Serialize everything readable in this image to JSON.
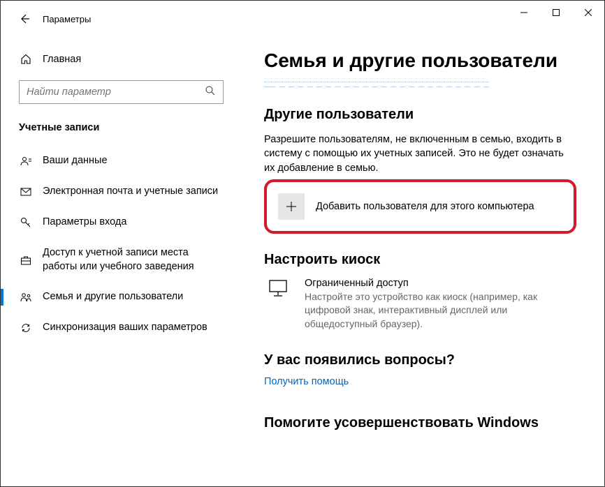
{
  "header": {
    "app_title": "Параметры"
  },
  "sidebar": {
    "home_label": "Главная",
    "search_placeholder": "Найти параметр",
    "section_label": "Учетные записи",
    "items": [
      {
        "label": "Ваши данные"
      },
      {
        "label": "Электронная почта и учетные записи"
      },
      {
        "label": "Параметры входа"
      },
      {
        "label": "Доступ к учетной записи места работы или учебного заведения"
      },
      {
        "label": "Семья и другие пользователи"
      },
      {
        "label": "Синхронизация ваших параметров"
      }
    ]
  },
  "content": {
    "page_title": "Семья и другие пользователи",
    "other_users_heading": "Другие пользователи",
    "other_users_desc": "Разрешите пользователям, не включенным в семью, входить в систему с помощью их учетных записей. Это не будет означать их добавление в семью.",
    "add_user_label": "Добавить пользователя для этого компьютера",
    "kiosk_heading": "Настроить киоск",
    "kiosk_title": "Ограниченный доступ",
    "kiosk_desc": "Настройте это устройство как киоск (например, как цифровой знак, интерактивный дисплей или общедоступный браузер).",
    "qa_heading": "У вас появились вопросы?",
    "qa_link": "Получить помощь",
    "improve_heading": "Помогите усовершенствовать Windows"
  }
}
